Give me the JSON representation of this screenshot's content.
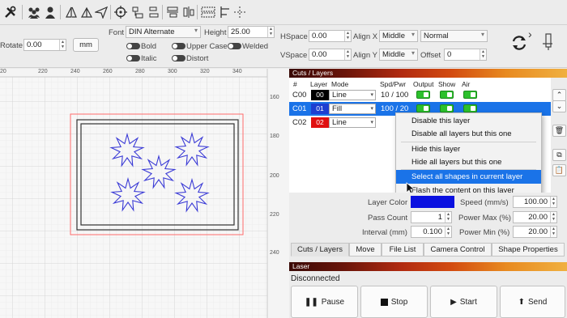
{
  "toolbar": {
    "icons": [
      "tools-icon",
      "users-icon",
      "user-icon",
      "flip-icon",
      "send-icon",
      "target-icon",
      "node-icon",
      "align-icon",
      "distribute-icon",
      "group-icon",
      "arrange-icon"
    ]
  },
  "text_props": {
    "rotate_label": "Rotate",
    "rotate_value": "0.00",
    "unit_button": "mm",
    "font_label": "Font",
    "font_value": "DIN Alternate",
    "height_label": "Height",
    "height_value": "25.00",
    "hspace_label": "HSpace",
    "hspace_value": "0.00",
    "vspace_label": "VSpace",
    "vspace_value": "0.00",
    "align_x_label": "Align X",
    "align_x_value": "Middle",
    "align_y_label": "Align Y",
    "align_y_value": "Middle",
    "style_value": "Normal",
    "offset_label": "Offset",
    "offset_value": "0",
    "bold": "Bold",
    "italic": "Italic",
    "upper_case": "Upper Case",
    "distort": "Distort",
    "welded": "Welded"
  },
  "ruler": {
    "top": [
      "20",
      "220",
      "240",
      "260",
      "280",
      "300",
      "320",
      "340"
    ],
    "right": [
      "160",
      "180",
      "200",
      "220",
      "240"
    ]
  },
  "cuts": {
    "title": "Cuts / Layers",
    "headers": {
      "num": "#",
      "layer": "Layer",
      "mode": "Mode",
      "spd": "Spd/Pwr",
      "output": "Output",
      "show": "Show",
      "air": "Air"
    },
    "rows": [
      {
        "id": "C00",
        "layer": "00",
        "color": "#000000",
        "mode": "Line",
        "spd": "10 / 100"
      },
      {
        "id": "C01",
        "layer": "01",
        "color": "#1e3fd0",
        "mode": "Fill",
        "spd": "100 / 20"
      },
      {
        "id": "C02",
        "layer": "02",
        "color": "#e01010",
        "mode": "Line",
        "spd": ""
      }
    ]
  },
  "context_menu": {
    "items": [
      "Disable this layer",
      "Disable all layers but this one",
      "Hide this layer",
      "Hide all layers but this one",
      "Select all shapes in current layer",
      "Flash the content on this layer"
    ]
  },
  "settings": {
    "layer_color_label": "Layer Color",
    "layer_color": "#0a10e0",
    "pass_count_label": "Pass Count",
    "pass_count": "1",
    "interval_label": "Interval (mm)",
    "interval": "0.100",
    "speed_label": "Speed (mm/s)",
    "speed": "100.00",
    "power_max_label": "Power Max (%)",
    "power_max": "20.00",
    "power_min_label": "Power Min (%)",
    "power_min": "20.00"
  },
  "tabs": [
    "Cuts / Layers",
    "Move",
    "File List",
    "Camera Control",
    "Shape Properties"
  ],
  "laser": {
    "title": "Laser",
    "status": "Disconnected",
    "pause": "Pause",
    "stop": "Stop",
    "start": "Start",
    "send": "Send"
  }
}
